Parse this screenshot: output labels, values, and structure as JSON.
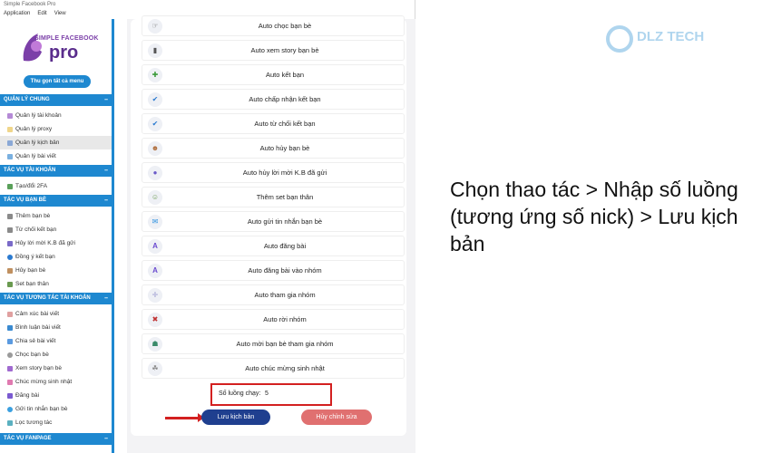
{
  "window": {
    "title": "Simple Facebook Pro",
    "menu": [
      "Application",
      "Edit",
      "View"
    ]
  },
  "sidebar": {
    "logo_line1": "SIMPLE FACEBOOK",
    "logo_line2": "pro",
    "collapse_label": "Thu gọn tất cả menu",
    "sections": [
      {
        "title": "QUẢN LÝ CHUNG",
        "items": [
          "Quản lý tài khoản",
          "Quản lý proxy",
          "Quản lý kịch bản",
          "Quản lý bài viết"
        ]
      },
      {
        "title": "TÁC VỤ TÀI KHOẢN",
        "items": [
          "Tạo/đổi 2FA"
        ]
      },
      {
        "title": "TÁC VỤ BẠN BÈ",
        "items": [
          "Thêm bạn bè",
          "Từ chối kết bạn",
          "Hủy lời mời K.B đã gửi",
          "Đồng ý kết bạn",
          "Hủy bạn bè",
          "Set bạn thân"
        ]
      },
      {
        "title": "TÁC VỤ TƯƠNG TÁC TÀI KHOẢN",
        "items": [
          "Cảm xúc bài viết",
          "Bình luận bài viết",
          "Chia sẻ bài viết",
          "Chọc bạn bè",
          "Xem story bạn bè",
          "Chúc mừng sinh nhật",
          "Đăng bài",
          "Gửi tin nhắn bạn bè",
          "Lọc tương tác"
        ]
      },
      {
        "title": "TÁC VỤ FANPAGE",
        "items": []
      }
    ]
  },
  "main": {
    "actions": [
      "Auto chọc bạn bè",
      "Auto xem story bạn bè",
      "Auto kết bạn",
      "Auto chấp nhận kết bạn",
      "Auto từ chối kết bạn",
      "Auto hủy bạn bè",
      "Auto hủy lời mời K.B đã gửi",
      "Thêm set bạn thân",
      "Auto gửi tin nhắn bạn bè",
      "Auto đăng bài",
      "Auto đăng bài vào nhóm",
      "Auto tham gia nhóm",
      "Auto rời nhóm",
      "Auto mời bạn bè tham gia nhóm",
      "Auto chúc mừng sinh nhật"
    ],
    "threads_label": "Số luồng chạy:",
    "threads_value": "5",
    "save_label": "Lưu kịch bản",
    "cancel_label": "Hủy chỉnh sửa"
  },
  "watermark": "DLZ TECH",
  "caption": "Chọn thao tác > Nhập số luồng (tương ứng số nick) > Lưu kịch bản",
  "colors": {
    "accent": "#1e88d0",
    "save": "#1f3f8f",
    "cancel": "#e07070",
    "highlight": "#d32020"
  }
}
